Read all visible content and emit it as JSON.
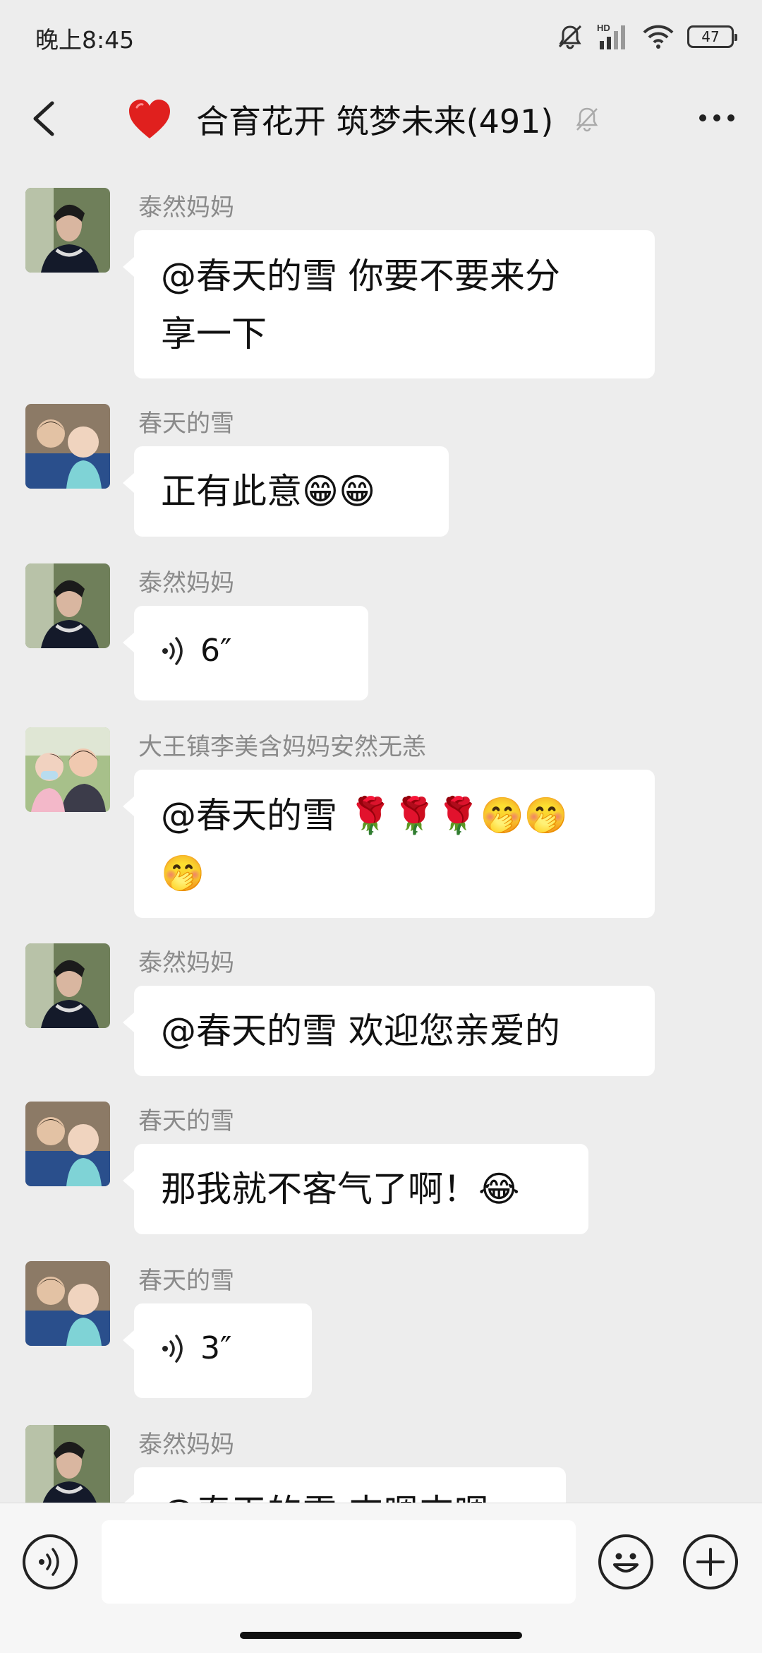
{
  "status_bar": {
    "time": "晚上8:45",
    "battery": "47",
    "network": "HD"
  },
  "header": {
    "title": "合育花开 筑梦未来(491)"
  },
  "messages": [
    {
      "sender": "泰然妈妈",
      "avatar": "woman-avatar",
      "text_lines": [
        "@春天的雪  你要不要来分",
        "享一下"
      ]
    },
    {
      "sender": "春天的雪",
      "avatar": "kids-avatar",
      "text": "正有此意😁😁"
    },
    {
      "sender": "泰然妈妈",
      "avatar": "woman-avatar",
      "voice": "6″"
    },
    {
      "sender": "大王镇李美含妈妈安然无恙",
      "avatar": "mother-child-avatar",
      "text_lines": [
        "@春天的雪  🌹🌹🌹🤭🤭",
        "🤭"
      ]
    },
    {
      "sender": "泰然妈妈",
      "avatar": "woman-avatar",
      "text": "@春天的雪  欢迎您亲爱的"
    },
    {
      "sender": "春天的雪",
      "avatar": "kids-avatar",
      "text": "那我就不客气了啊！😂"
    },
    {
      "sender": "春天的雪",
      "avatar": "kids-avatar",
      "voice": "3″"
    },
    {
      "sender": "泰然妈妈",
      "avatar": "woman-avatar",
      "text": "@春天的雪  支嗯支嗯"
    }
  ],
  "input": {
    "value": "",
    "placeholder": ""
  },
  "colors": {
    "background": "#ededed",
    "bubble": "#ffffff",
    "sender": "#8a8a8a",
    "heart": "#e0201e"
  },
  "icons": [
    "back-icon",
    "heart-icon",
    "mute-bell-icon",
    "more-icon",
    "voice-input-icon",
    "emoji-icon",
    "plus-icon",
    "voice-wave-icon"
  ]
}
